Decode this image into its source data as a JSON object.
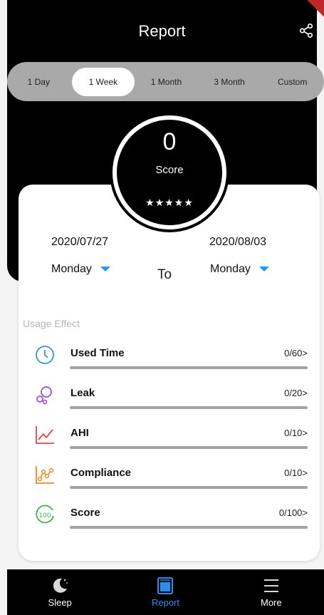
{
  "header": {
    "title": "Report"
  },
  "range_tabs": [
    {
      "label": "1 Day",
      "active": false
    },
    {
      "label": "1 Week",
      "active": true
    },
    {
      "label": "1 Month",
      "active": false
    },
    {
      "label": "3 Month",
      "active": false
    },
    {
      "label": "Custom",
      "active": false
    }
  ],
  "score": {
    "value": "0",
    "label": "Score",
    "stars": "★★★★★"
  },
  "date_range": {
    "from_date": "2020/07/27",
    "from_day": "Monday",
    "to_label": "To",
    "to_date": "2020/08/03",
    "to_day": "Monday"
  },
  "usage": {
    "section_label": "Usage Effect",
    "items": [
      {
        "name": "Used Time",
        "value": "0/60>",
        "icon": "clock-icon",
        "color": "#3b8fe0"
      },
      {
        "name": "Leak",
        "value": "0/20>",
        "icon": "bubbles-icon",
        "color": "#a24bd8"
      },
      {
        "name": "AHI",
        "value": "0/10>",
        "icon": "line-chart-icon",
        "color": "#e0454f"
      },
      {
        "name": "Compliance",
        "value": "0/10>",
        "icon": "compliance-chart-icon",
        "color": "#f08a24"
      },
      {
        "name": "Score",
        "value": "0/100>",
        "icon": "score-100-icon",
        "color": "#39b44a"
      }
    ]
  },
  "nav": {
    "items": [
      {
        "label": "Sleep",
        "icon": "moon-icon",
        "active": false
      },
      {
        "label": "Report",
        "icon": "report-icon",
        "active": true
      },
      {
        "label": "More",
        "icon": "menu-icon",
        "active": false
      }
    ],
    "active_color": "#2d8cf0"
  },
  "colors": {
    "accent": "#2196f3",
    "track": "#a3a3a3",
    "header_bg": "#000000"
  }
}
